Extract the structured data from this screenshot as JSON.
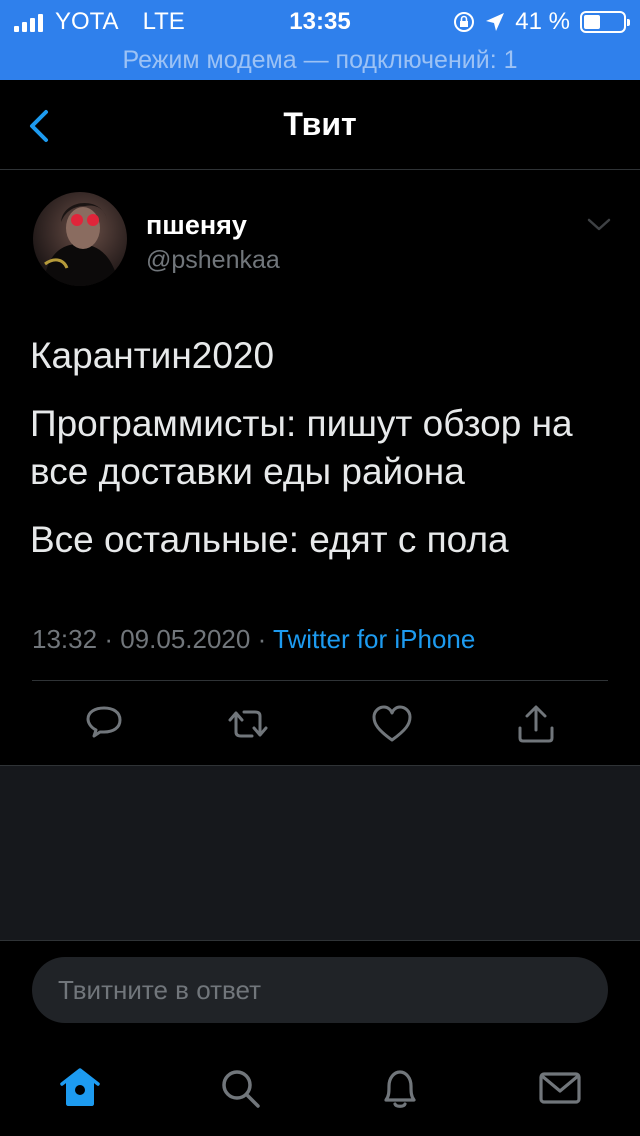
{
  "status_bar": {
    "carrier": "YOTA",
    "network": "LTE",
    "time": "13:35",
    "battery": "41 %",
    "battery_level": 0.41,
    "hotspot": "Режим модема — подключений: 1"
  },
  "nav": {
    "title": "Твит"
  },
  "tweet": {
    "author_name": "пшеняу",
    "author_handle": "@pshenkaa",
    "paragraphs": [
      "Карантин2020",
      "Программисты: пишут обзор на все доставки еды района",
      "Все остальные: едят с пола"
    ],
    "time": "13:32",
    "date": "09.05.2020",
    "separator": "·",
    "source": "Twitter for iPhone"
  },
  "reply": {
    "placeholder": "Твитните в ответ"
  },
  "colors": {
    "accent": "#1d9bf0",
    "status_bar": "#2f80ec",
    "muted": "#71767b"
  },
  "icons": {
    "actions": [
      "reply-icon",
      "retweet-icon",
      "like-icon",
      "share-icon"
    ],
    "tabs": [
      "home-icon",
      "search-icon",
      "notifications-icon",
      "messages-icon"
    ]
  }
}
